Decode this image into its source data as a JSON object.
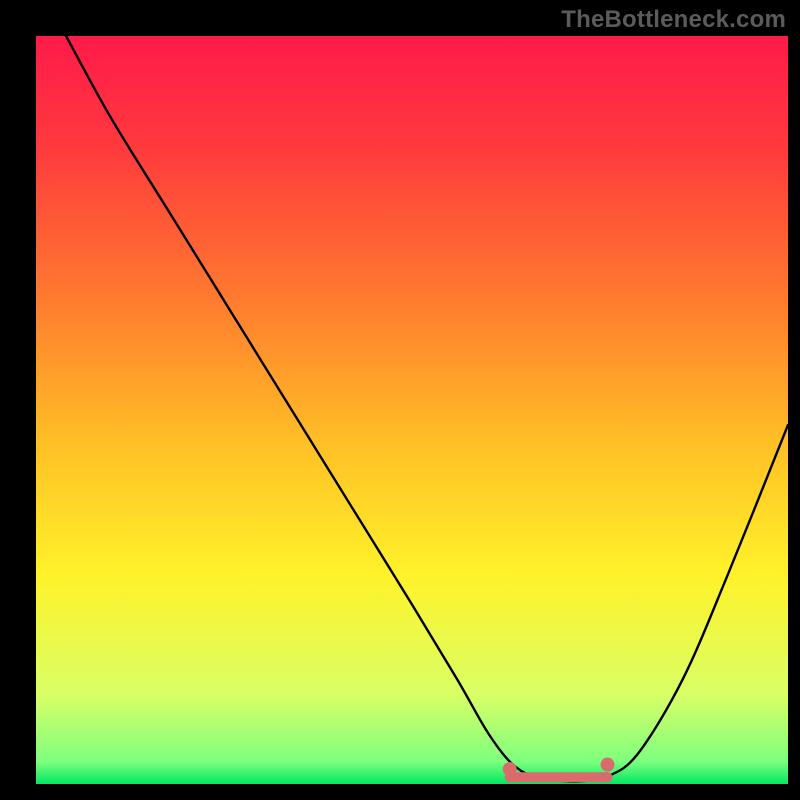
{
  "watermark": "TheBottleneck.com",
  "chart_data": {
    "type": "line",
    "title": "",
    "xlabel": "",
    "ylabel": "",
    "xlim": [
      0,
      100
    ],
    "ylim": [
      0,
      100
    ],
    "background_gradient": {
      "stops": [
        {
          "offset": 0.0,
          "color": "#ff1a4a"
        },
        {
          "offset": 0.15,
          "color": "#ff3a3d"
        },
        {
          "offset": 0.35,
          "color": "#ff7a2f"
        },
        {
          "offset": 0.55,
          "color": "#ffc126"
        },
        {
          "offset": 0.72,
          "color": "#fff22a"
        },
        {
          "offset": 0.88,
          "color": "#d9ff66"
        },
        {
          "offset": 0.97,
          "color": "#7eff7e"
        },
        {
          "offset": 1.0,
          "color": "#00e961"
        }
      ]
    },
    "series": [
      {
        "name": "bottleneck-curve",
        "color": "#000000",
        "x": [
          4,
          10,
          18,
          26,
          34,
          42,
          50,
          56,
          60,
          63,
          66,
          70,
          73,
          76,
          80,
          86,
          92,
          100
        ],
        "y": [
          100,
          89,
          76,
          63,
          50,
          37,
          24,
          14,
          7,
          3,
          1,
          0.4,
          0.4,
          1,
          4,
          14,
          28,
          48
        ]
      }
    ],
    "flat_zone": {
      "color": "#d86b6b",
      "x_start": 63,
      "x_end": 76,
      "y": 0.9,
      "dot_left": {
        "x": 63,
        "y": 2.0
      },
      "dot_right": {
        "x": 76,
        "y": 2.6
      }
    }
  }
}
